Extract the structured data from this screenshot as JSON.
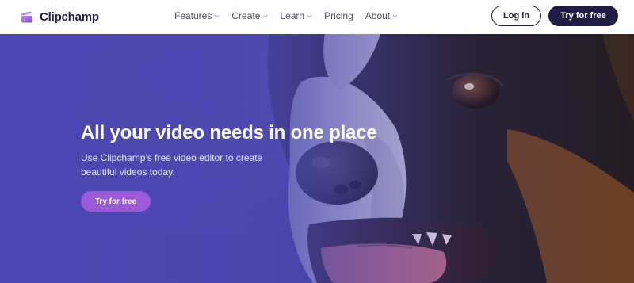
{
  "brand": {
    "name": "Clipchamp"
  },
  "nav": {
    "items": [
      {
        "label": "Features",
        "has_dropdown": true
      },
      {
        "label": "Create",
        "has_dropdown": true
      },
      {
        "label": "Learn",
        "has_dropdown": true
      },
      {
        "label": "Pricing",
        "has_dropdown": false
      },
      {
        "label": "About",
        "has_dropdown": true
      }
    ]
  },
  "header_actions": {
    "login_label": "Log in",
    "try_label": "Try for free"
  },
  "hero": {
    "title": "All your video needs in one place",
    "subtitle": "Use Clipchamp’s free video editor to create beautiful videos today.",
    "cta_label": "Try for free"
  },
  "colors": {
    "brand_navy": "#1f1d46",
    "cta_purple": "#9b5bd9",
    "hero_overlay": "#4b47b0"
  }
}
